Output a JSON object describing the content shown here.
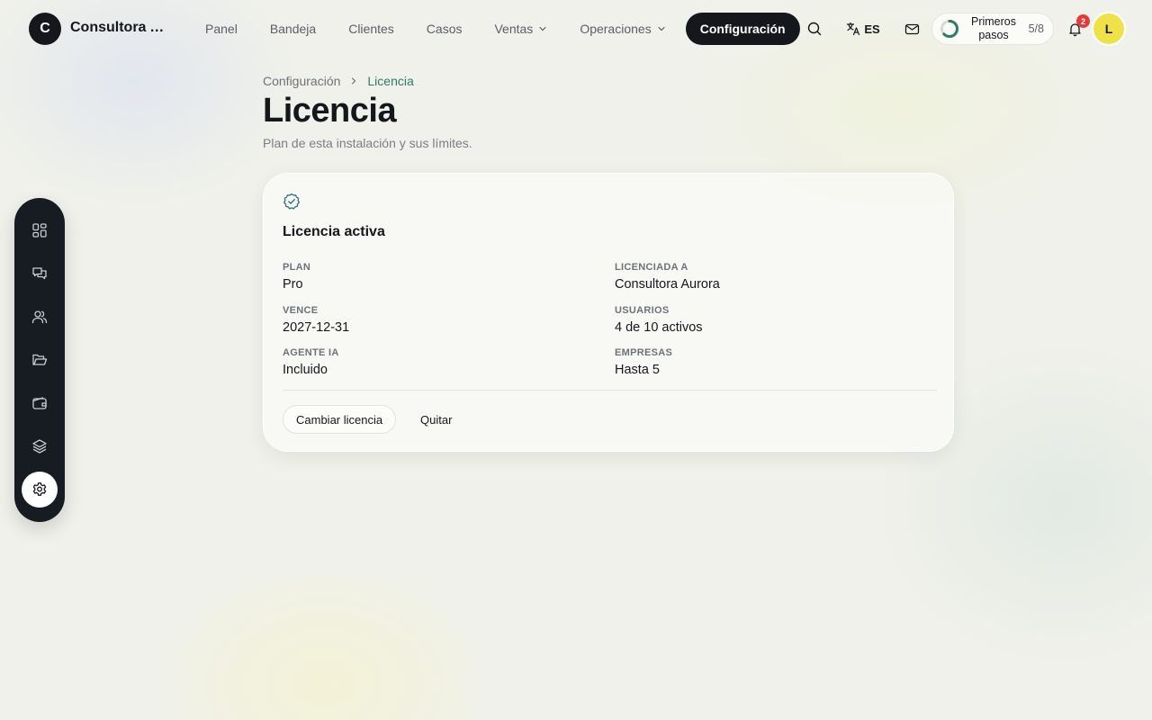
{
  "brand": {
    "logo_letter": "C",
    "name": "Consultora A..."
  },
  "nav": {
    "items": [
      {
        "label": "Panel"
      },
      {
        "label": "Bandeja"
      },
      {
        "label": "Clientes"
      },
      {
        "label": "Casos"
      },
      {
        "label": "Ventas",
        "dropdown": true
      },
      {
        "label": "Operaciones",
        "dropdown": true
      },
      {
        "label": "Configuración",
        "active": true
      }
    ]
  },
  "toolbar": {
    "language": "ES",
    "onboarding": {
      "label": "Primeros pasos",
      "count": "5/8",
      "progress": 0.625
    },
    "notifications_count": "2",
    "avatar_letter": "L"
  },
  "sidebar": {
    "items": [
      {
        "icon": "grid-icon"
      },
      {
        "icon": "chat-icon"
      },
      {
        "icon": "users-icon"
      },
      {
        "icon": "folder-icon"
      },
      {
        "icon": "wallet-icon"
      },
      {
        "icon": "layers-icon"
      },
      {
        "icon": "gear-icon",
        "active": true
      }
    ]
  },
  "breadcrumb": {
    "root": "Configuración",
    "current": "Licencia"
  },
  "page": {
    "title": "Licencia",
    "subtitle": "Plan de esta instalación y sus límites."
  },
  "license": {
    "status": "Licencia activa",
    "fields": {
      "plan": {
        "label": "PLAN",
        "value": "Pro"
      },
      "licensed_to": {
        "label": "LICENCIADA A",
        "value": "Consultora Aurora"
      },
      "expires": {
        "label": "VENCE",
        "value": "2027-12-31"
      },
      "users": {
        "label": "USUARIOS",
        "value": "4 de 10 activos"
      },
      "ai_agent": {
        "label": "AGENTE IA",
        "value": "Incluido"
      },
      "companies": {
        "label": "EMPRESAS",
        "value": "Hasta 5"
      }
    },
    "actions": {
      "change": "Cambiar licencia",
      "remove": "Quitar"
    }
  },
  "colors": {
    "accent": "#2f7a66",
    "dark": "#14171c",
    "avatar": "#efe14a",
    "badge": "#e23b3b"
  }
}
